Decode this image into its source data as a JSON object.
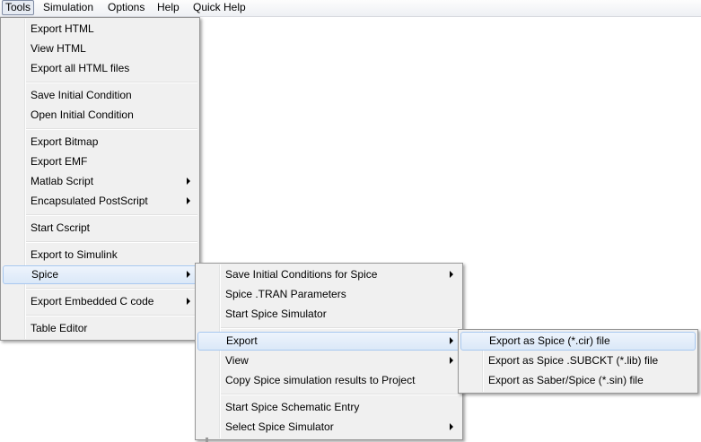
{
  "menubar": {
    "items": [
      "Tools",
      "Simulation",
      "Options",
      "Help",
      "Quick Help"
    ]
  },
  "tools_menu": {
    "items": [
      "Export HTML",
      "View HTML",
      "Export all HTML files",
      "Save Initial Condition",
      "Open Initial Condition",
      "Export Bitmap",
      "Export EMF",
      "Matlab Script",
      "Encapsulated PostScript",
      "Start Cscript",
      "Export to Simulink",
      "Spice",
      "Export Embedded C code",
      "Table Editor"
    ]
  },
  "spice_menu": {
    "items": [
      "Save Initial Conditions for Spice",
      "Spice .TRAN Parameters",
      "Start Spice Simulator",
      "Export",
      "View",
      "Copy Spice simulation results to Project",
      "Start Spice Schematic Entry",
      "Select Spice Simulator"
    ]
  },
  "export_menu": {
    "items": [
      "Export as Spice (*.cir) file",
      "Export as Spice .SUBCKT (*.lib) file",
      "Export as Saber/Spice (*.sin) file"
    ]
  }
}
